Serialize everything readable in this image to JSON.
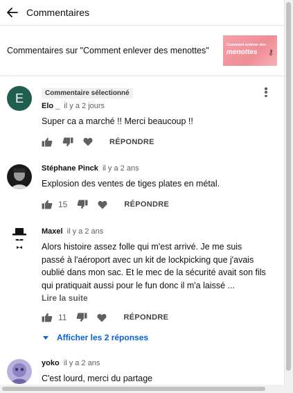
{
  "header": {
    "title": "Commentaires",
    "back_icon": "arrow-left-icon"
  },
  "video": {
    "title": "Commentaires sur \"Comment enlever des menottes\"",
    "thumb_line1": "Comment enlever des",
    "thumb_line2": "menottes",
    "thumb_colors": [
      "#f6a0a8",
      "#f08d97"
    ]
  },
  "comments": [
    {
      "badge": "Commentaire sélectionné",
      "avatar_letter": "E",
      "avatar_color": "#1e5f4f",
      "author": "Elo _",
      "time": "il y a 2 jours",
      "text": "Super ca a marché !! Merci beaucoup !!",
      "likes": "",
      "reply_label": "RÉPONDRE"
    },
    {
      "author": "Stéphane Pinck",
      "time": "il y a 2 ans",
      "text": "Explosion des ventes de tiges plates en métal.",
      "likes": "15",
      "reply_label": "RÉPONDRE"
    },
    {
      "author": "Maxel",
      "time": "il y a 2 ans",
      "text": "Alors histoire assez folle qui m'est arrivé. Je me suis passé à l'aéroport avec un kit de lockpicking que j'avais oublié dans mon sac. Et le mec de la sécurité avait son fils qui pratiquait aussi pour le fun donc il m'a laissé ...",
      "read_more": "Lire la suite",
      "likes": "11",
      "reply_label": "RÉPONDRE",
      "show_replies": "Afficher les 2 réponses"
    },
    {
      "author": "yoko",
      "time": "il y a 2 ans",
      "text": "C'est lourd, merci du partage"
    }
  ],
  "colors": {
    "link_blue": "#065fd4",
    "muted": "#606060"
  }
}
